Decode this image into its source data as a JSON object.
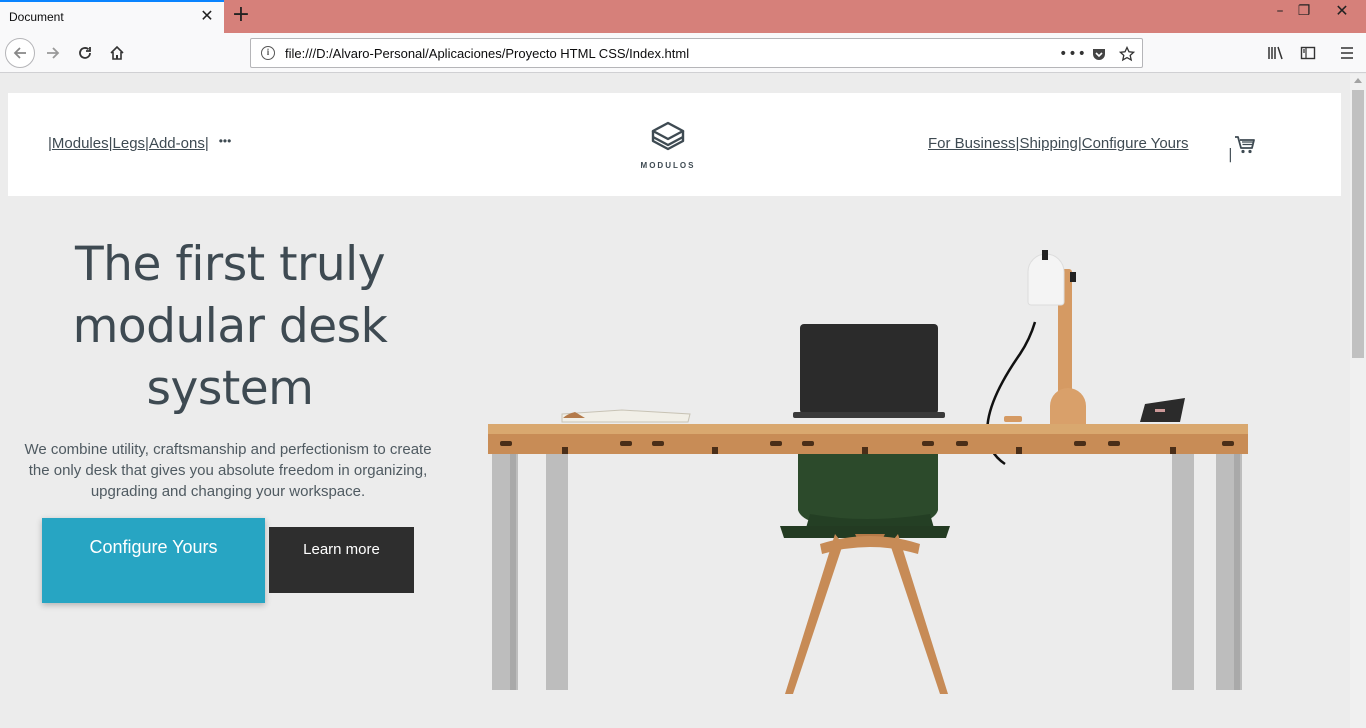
{
  "browser": {
    "tab_title": "Document",
    "url": "file:///D:/Alvaro-Personal/Aplicaciones/Proyecto HTML CSS/Index.html"
  },
  "header": {
    "nav_left": [
      {
        "label": "Modules"
      },
      {
        "label": "Legs"
      },
      {
        "label": "Add-ons"
      }
    ],
    "more_label": "•••",
    "logo_text": "MODULOS",
    "nav_right": [
      {
        "label": "For Business"
      },
      {
        "label": "Shipping"
      },
      {
        "label": "Configure Yours"
      }
    ]
  },
  "hero": {
    "title_line1": "The first truly",
    "title_line2": "modular desk",
    "title_line3": "system",
    "subtitle": "We combine utility, craftsmanship and perfectionism to create the only desk that gives you absolute freedom in organizing, upgrading and changing your workspace.",
    "primary_button": "Configure Yours",
    "secondary_button": "Learn more"
  },
  "colors": {
    "accent": "#27a5c3",
    "dark_button": "#2e2e2e",
    "text": "#3e4a52",
    "tabbar": "#d6807a"
  }
}
